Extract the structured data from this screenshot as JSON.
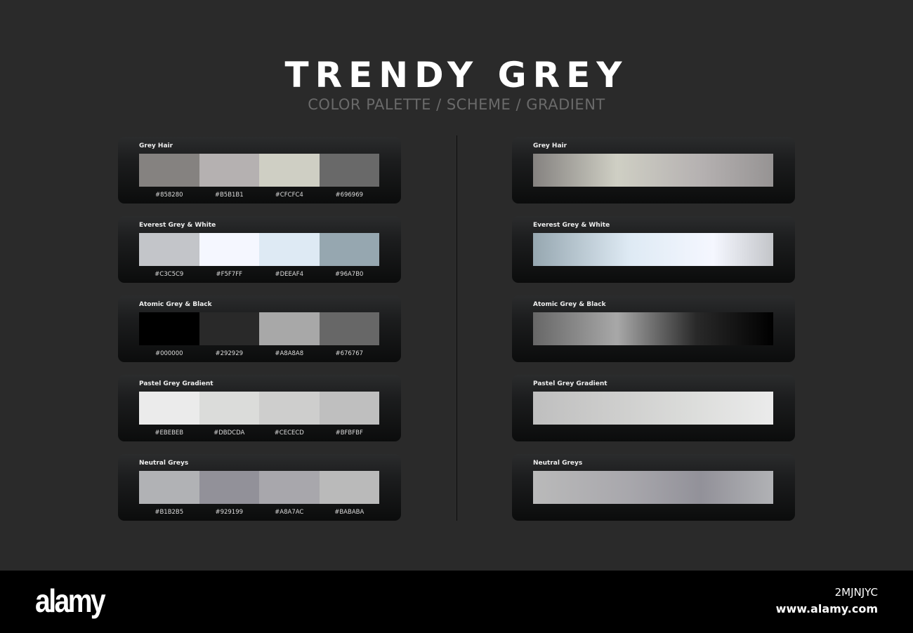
{
  "header": {
    "title": "TRENDY GREY",
    "subtitle": "COLOR PALETTE / SCHEME / GRADIENT"
  },
  "palettes": [
    {
      "name": "Grey Hair",
      "colors": [
        "#858280",
        "#B5B1B1",
        "#CFCFC4",
        "#696969"
      ],
      "gradient": "linear-gradient(90deg,#858280 0%,#CFCFC4 35%,#B5B1B1 70%,#969393 100%)"
    },
    {
      "name": "Everest Grey & White",
      "colors": [
        "#C3C5C9",
        "#F5F7FF",
        "#DEEAF4",
        "#96A7B0"
      ],
      "gradient": "linear-gradient(90deg,#96A7B0 0%,#DEEAF4 40%,#F5F7FF 75%,#C3C5C9 100%)"
    },
    {
      "name": "Atomic Grey & Black",
      "colors": [
        "#000000",
        "#292929",
        "#A8A8A8",
        "#676767"
      ],
      "gradient": "linear-gradient(90deg,#676767 0%,#A8A8A8 35%,#292929 68%,#000000 100%)"
    },
    {
      "name": "Pastel Grey Gradient",
      "colors": [
        "#EBEBEB",
        "#DBDCDA",
        "#CECECD",
        "#BFBFBF"
      ],
      "gradient": "linear-gradient(90deg,#BFBFBF 0%,#CECECD 35%,#DBDCDA 65%,#EBEBEB 100%)"
    },
    {
      "name": "Neutral Greys",
      "colors": [
        "#B1B2B5",
        "#929199",
        "#A8A7AC",
        "#BABABA"
      ],
      "gradient": "linear-gradient(90deg,#BABABA 0%,#A8A7AC 40%,#929199 70%,#B1B2B5 100%)"
    }
  ],
  "footer": {
    "logo": "alamy",
    "image_id": "2MJNJYC",
    "site": "www.alamy.com"
  }
}
